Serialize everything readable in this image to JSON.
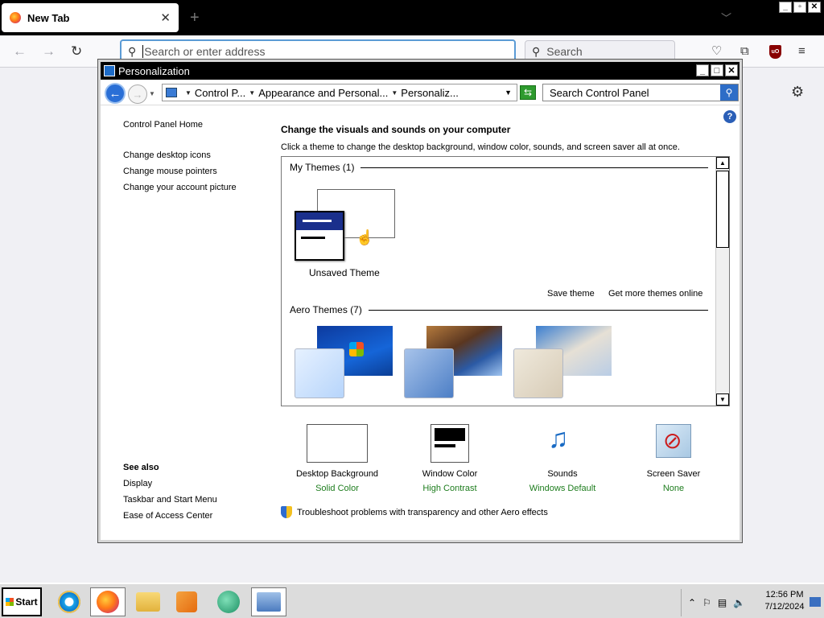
{
  "browser": {
    "tab_title": "New Tab",
    "tab_close": "✕",
    "new_tab": "+",
    "url_placeholder": "Search or enter address",
    "search_placeholder": "Search"
  },
  "window": {
    "title": "Personalization",
    "breadcrumb": [
      "Control P...",
      "Appearance and Personal...",
      "Personaliz..."
    ],
    "search_placeholder": "Search Control Panel",
    "help": "?"
  },
  "left_nav": {
    "home": "Control Panel Home",
    "links": [
      "Change desktop icons",
      "Change mouse pointers",
      "Change your account picture"
    ],
    "see_also_header": "See also",
    "see_also": [
      "Display",
      "Taskbar and Start Menu",
      "Ease of Access Center"
    ]
  },
  "main": {
    "heading": "Change the visuals and sounds on your computer",
    "subheading": "Click a theme to change the desktop background, window color, sounds, and screen saver all at once.",
    "my_themes_header": "My Themes (1)",
    "unsaved_theme": "Unsaved Theme",
    "save_theme": "Save theme",
    "get_more_themes": "Get more themes online",
    "aero_themes_header": "Aero Themes (7)",
    "options": [
      {
        "name": "Desktop Background",
        "value": "Solid Color"
      },
      {
        "name": "Window Color",
        "value": "High Contrast"
      },
      {
        "name": "Sounds",
        "value": "Windows Default"
      },
      {
        "name": "Screen Saver",
        "value": "None"
      }
    ],
    "troubleshoot": "Troubleshoot problems with transparency and other Aero effects"
  },
  "taskbar": {
    "start": "Start",
    "time": "12:56 PM",
    "date": "7/12/2024"
  }
}
